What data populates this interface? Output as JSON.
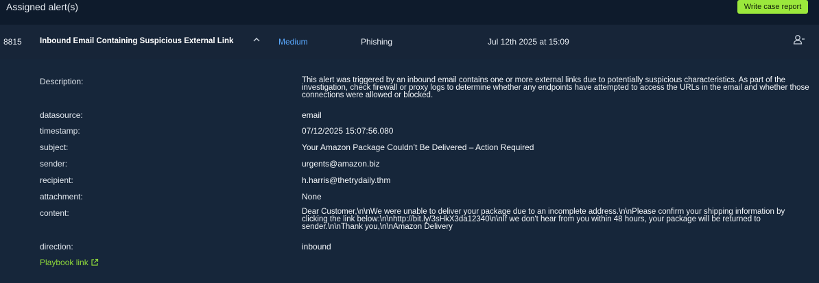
{
  "header": {
    "title": "Assigned alert(s)",
    "write_report_label": "Write case report"
  },
  "alert": {
    "id": "8815",
    "title": "Inbound Email Containing Suspicious External Link",
    "chevron": "^",
    "severity": "Medium",
    "type": "Phishing",
    "date": "Jul 12th 2025 at 15:09",
    "assign_icon": "user-minus-icon"
  },
  "details": [
    {
      "key": "Description:",
      "value": "This alert was triggered by an inbound email contains one or more external links due to potentially suspicious characteristics. As part of the investigation, check firewall or proxy logs to determine whether any endpoints have attempted to access the URLs in the email and whether those connections were allowed or blocked."
    },
    {
      "key": "datasource:",
      "value": "email"
    },
    {
      "key": "timestamp:",
      "value": "07/12/2025 15:07:56.080"
    },
    {
      "key": "subject:",
      "value": "Your Amazon Package Couldn’t Be Delivered – Action Required"
    },
    {
      "key": "sender:",
      "value": "urgents@amazon.biz"
    },
    {
      "key": "recipient:",
      "value": "h.harris@thetrydaily.thm"
    },
    {
      "key": "attachment:",
      "value": "None"
    },
    {
      "key": "content:",
      "value": "Dear Customer,\\n\\nWe were unable to deliver your package due to an incomplete address.\\n\\nPlease confirm your shipping information by clicking the link below:\\n\\nhttp://bit.ly/3sHkX3da12340\\n\\nIf we don't hear from you within 48 hours, your package will be returned to sender.\\n\\nThank you,\\n\\nAmazon Delivery"
    },
    {
      "key": "direction:",
      "value": "inbound"
    }
  ],
  "playbook_label": "Playbook link",
  "colors": {
    "background": "#0e1b2c",
    "accent_green": "#9be83c",
    "severity_blue": "#5aa9ff",
    "link_green": "#8fd93a"
  }
}
